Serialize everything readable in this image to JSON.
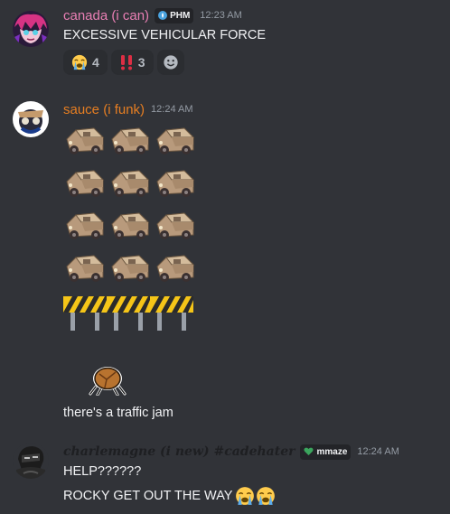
{
  "messages": [
    {
      "username": "canada (i can)",
      "username_color": "#e97fb4",
      "tag": "PHM",
      "timestamp": "12:23 AM",
      "text": "EXCESSIVE VEHICULAR FORCE",
      "reactions": [
        {
          "emoji": "loudly-crying-face",
          "count": "4"
        },
        {
          "emoji": "double-exclamation",
          "count": "3"
        },
        {
          "emoji": "add-reaction-icon",
          "count": ""
        }
      ]
    },
    {
      "username": "sauce (i funk)",
      "username_color": "#e67e22",
      "timestamp": "12:24 AM",
      "emoji_grid": {
        "car_emoji": "cardboard-car-emoji",
        "barrier_emoji": "construction-barrier-emoji",
        "rock_emoji": "rock-crab-emoji"
      },
      "text": "there's a traffic jam"
    },
    {
      "username": "charlemagne (i new) #cadehater",
      "username_color": "#1e1f22",
      "tag": "mmaze",
      "timestamp": "12:24 AM",
      "lines": [
        "HELP??????",
        "ROCKY GET OUT THE WAY"
      ]
    }
  ],
  "colors": {
    "background": "#313338",
    "text": "#f2f3f5",
    "timestamp": "#949ba4"
  }
}
